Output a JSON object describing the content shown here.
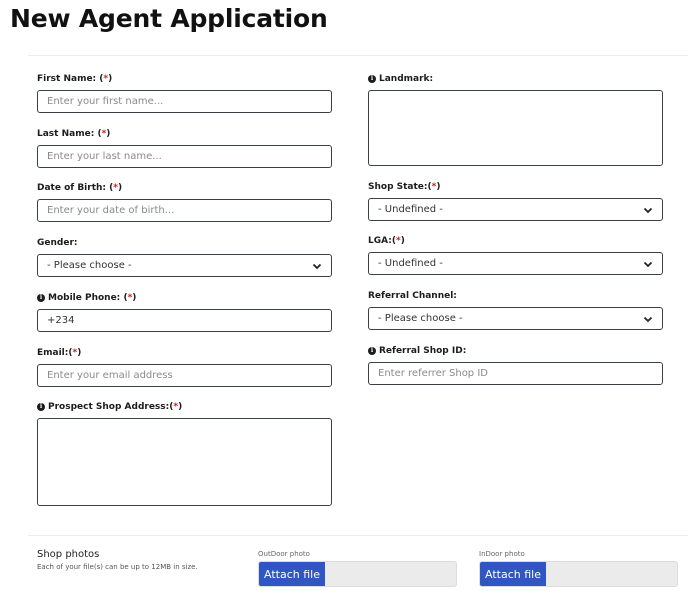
{
  "page": {
    "title": "New Agent Application"
  },
  "required_marker": "*",
  "form": {
    "left": {
      "first_name": {
        "label": "First Name:",
        "required": true,
        "placeholder": "Enter your first name...",
        "value": ""
      },
      "last_name": {
        "label": "Last Name:",
        "required": true,
        "placeholder": "Enter your last name...",
        "value": ""
      },
      "dob": {
        "label": "Date of Birth:",
        "required": true,
        "placeholder": "Enter your date of birth...",
        "value": ""
      },
      "gender": {
        "label": "Gender:",
        "required": false,
        "selected": "- Please choose -"
      },
      "mobile_phone": {
        "label": "Mobile Phone:",
        "required": true,
        "info_icon": true,
        "value": "+234"
      },
      "email": {
        "label": "Email:",
        "required": true,
        "placeholder": "Enter your email address",
        "value": ""
      },
      "shop_address": {
        "label": "Prospect Shop Address:",
        "required": true,
        "info_icon": true,
        "value": ""
      }
    },
    "right": {
      "landmark": {
        "label": "Landmark:",
        "required": false,
        "info_icon": true,
        "value": ""
      },
      "shop_state": {
        "label": "Shop State:",
        "required": true,
        "selected": "- Undefined -"
      },
      "lga": {
        "label": "LGA:",
        "required": true,
        "selected": "- Undefined -"
      },
      "referral_channel": {
        "label": "Referral Channel:",
        "required": false,
        "selected": "- Please choose -"
      },
      "referral_shop_id": {
        "label": "Referral Shop ID:",
        "required": false,
        "info_icon": true,
        "placeholder": "Enter referrer Shop ID",
        "value": ""
      }
    }
  },
  "photos": {
    "title": "Shop photos",
    "subtitle": "Each of your file(s) can be up to 12MB in size.",
    "outdoor": {
      "label": "OutDoor photo",
      "button": "Attach file"
    },
    "indoor": {
      "label": "InDoor photo",
      "button": "Attach file"
    }
  },
  "icons": {
    "info": "info-circle-icon",
    "chevron": "chevron-down-icon"
  },
  "colors": {
    "required": "#c81e1e",
    "attach_button": "#2f56c2",
    "upload_bg": "#ebebeb"
  }
}
